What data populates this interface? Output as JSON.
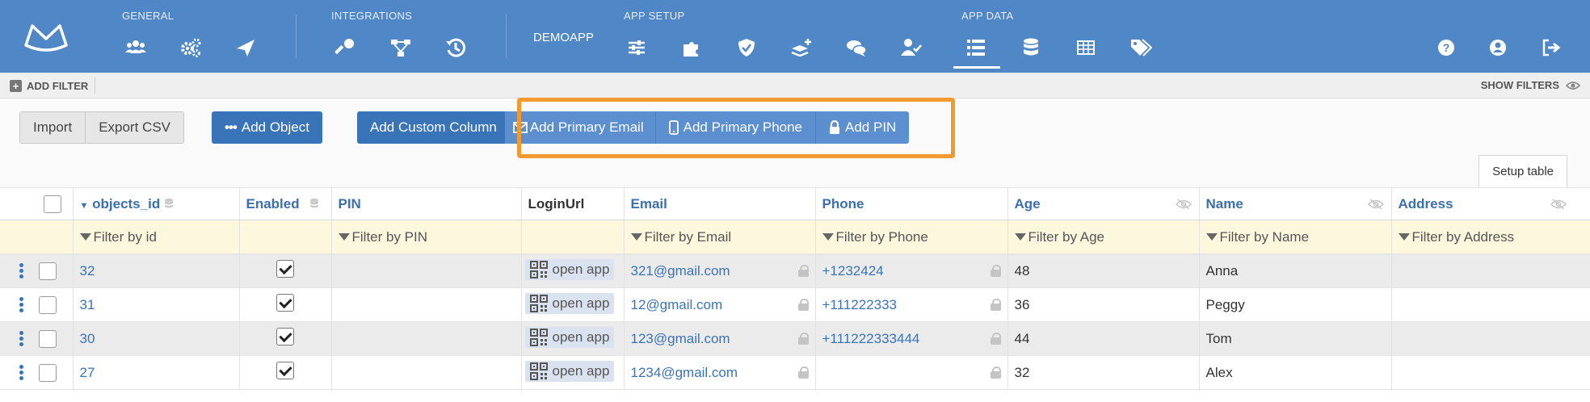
{
  "nav": {
    "groups": [
      {
        "label": "GENERAL"
      },
      {
        "label": "INTEGRATIONS"
      },
      {
        "label": "APP SETUP"
      },
      {
        "label": "APP DATA"
      }
    ],
    "app_name": "DEMOAPP",
    "icons": {
      "general": [
        "users-icon",
        "gears-icon",
        "send-icon"
      ],
      "integrations": [
        "key-icon",
        "hierarchy-icon",
        "history-icon"
      ],
      "app_setup": [
        "sliders-icon",
        "puzzle-icon",
        "shield-icon",
        "layers-add-icon",
        "chat-icon",
        "user-check-icon"
      ],
      "app_data": [
        "list-icon",
        "database-icon",
        "table-icon",
        "tags-icon"
      ],
      "right": [
        "help-icon",
        "account-icon",
        "logout-icon"
      ]
    },
    "accent_color": "#4f87c7"
  },
  "filterbar": {
    "add_filter_label": "ADD FILTER",
    "show_filters_label": "SHOW FILTERS"
  },
  "toolbar": {
    "import_label": "Import",
    "export_csv_label": "Export CSV",
    "add_object_label": "Add Object",
    "add_custom_column_label": "Add Custom Column",
    "add_primary_email_label": "Add Primary Email",
    "add_primary_phone_label": "Add Primary Phone",
    "add_pin_label": "Add PIN",
    "setup_table_label": "Setup table",
    "highlight_color": "#f29a2e"
  },
  "table": {
    "columns": {
      "objects_id": "objects_id",
      "enabled": "Enabled",
      "pin": "PIN",
      "loginurl": "LoginUrl",
      "email": "Email",
      "phone": "Phone",
      "age": "Age",
      "name": "Name",
      "address": "Address"
    },
    "filters": {
      "id": "Filter by id",
      "pin": "Filter by PIN",
      "email": "Filter by Email",
      "phone": "Filter by Phone",
      "age": "Filter by Age",
      "name": "Filter by Name",
      "address": "Filter by Address"
    },
    "open_app_label": "open app",
    "rows": [
      {
        "id": "32",
        "enabled": true,
        "pin": "",
        "email": "321@gmail.com",
        "phone": "+1232424",
        "age": "48",
        "name": "Anna",
        "address": ""
      },
      {
        "id": "31",
        "enabled": true,
        "pin": "",
        "email": "12@gmail.com",
        "phone": "+111222333",
        "age": "36",
        "name": "Peggy",
        "address": ""
      },
      {
        "id": "30",
        "enabled": true,
        "pin": "",
        "email": "123@gmail.com",
        "phone": "+111222333444",
        "age": "44",
        "name": "Tom",
        "address": ""
      },
      {
        "id": "27",
        "enabled": true,
        "pin": "",
        "email": "1234@gmail.com",
        "phone": "",
        "age": "32",
        "name": "Alex",
        "address": ""
      }
    ]
  }
}
